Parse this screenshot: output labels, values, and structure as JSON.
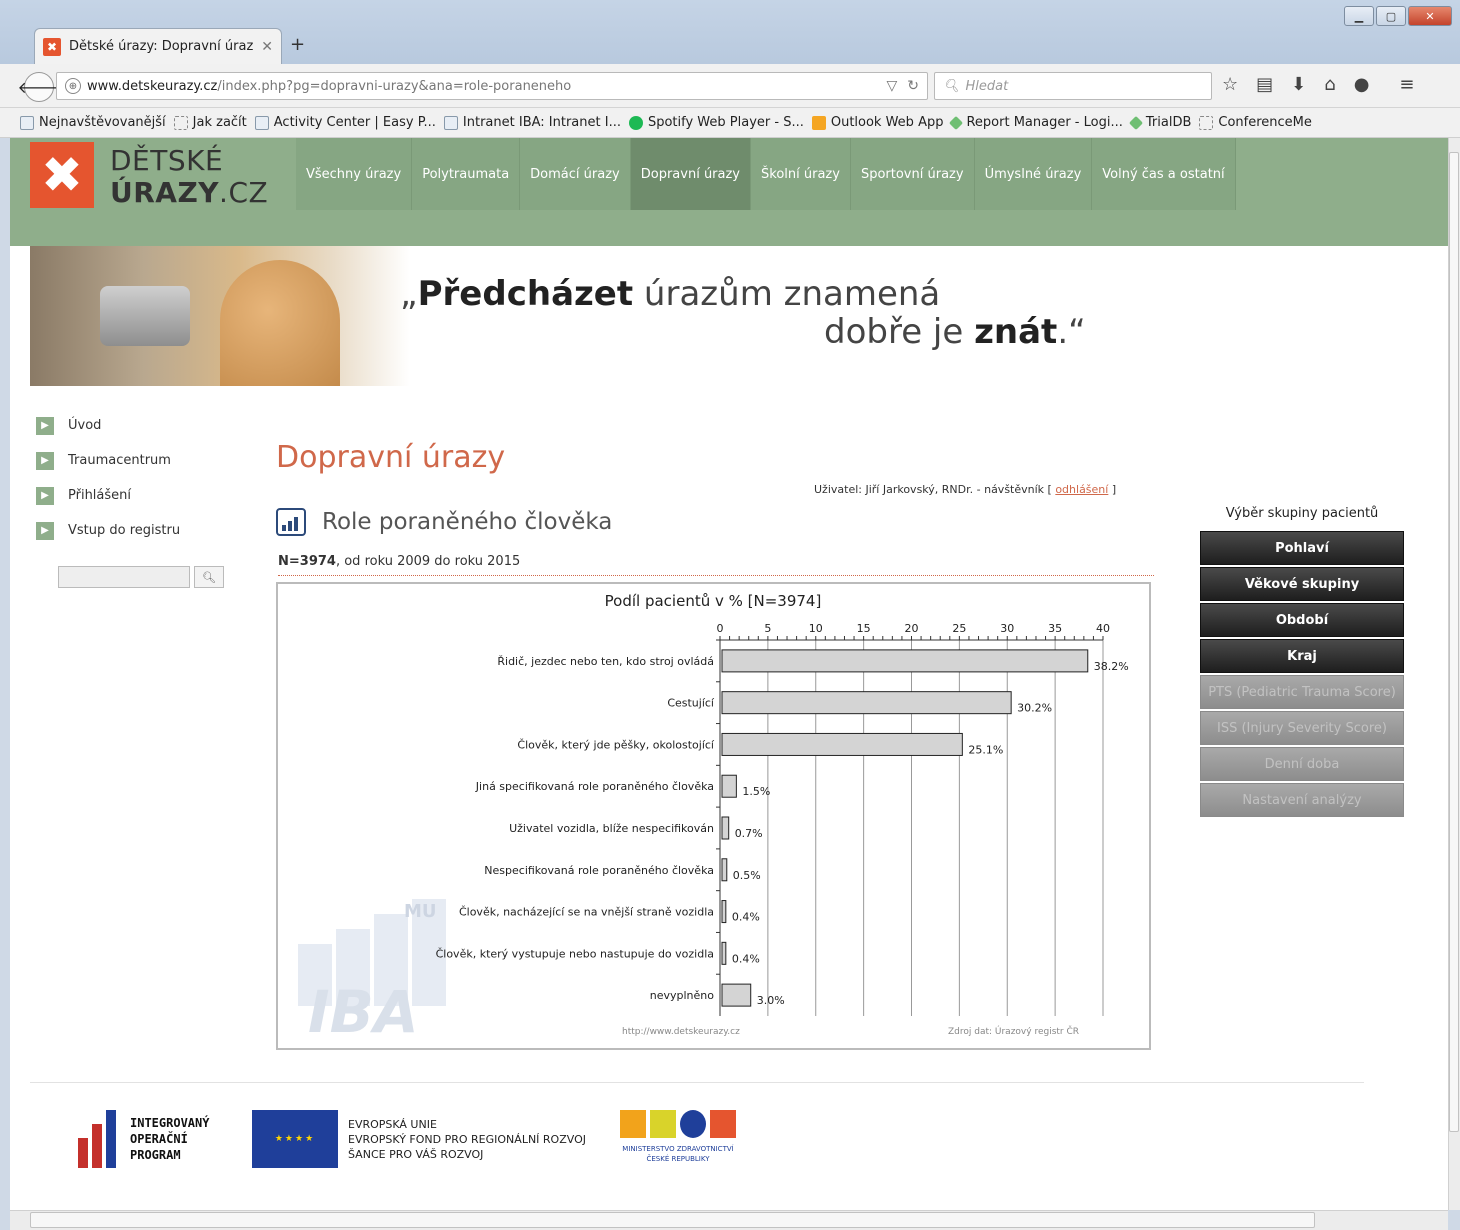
{
  "browser": {
    "tab_title": "Dětské úrazy: Dopravní úrazy",
    "url_domain": "www.detskeurazy.cz",
    "url_path": "/index.php?pg=dopravni-urazy&ana=role-poraneneho",
    "search_placeholder": "Hledat",
    "bookmarks": [
      "Nejnavštěvovanější",
      "Jak začít",
      "Activity Center | Easy P...",
      "Intranet IBA: Intranet I...",
      "Spotify Web Player - S...",
      "Outlook Web App",
      "Report Manager - Logi...",
      "TrialDB",
      "ConferenceMe"
    ]
  },
  "logo": {
    "line1": "DĚTSKÉ",
    "line2_bold": "ÚRAZY",
    "line2_rest": ".CZ"
  },
  "mainnav": [
    "Všechny úrazy",
    "Polytraumata",
    "Domácí úrazy",
    "Dopravní úrazy",
    "Školní úrazy",
    "Sportovní úrazy",
    "Úmyslné úrazy",
    "Volný čas a ostatní"
  ],
  "mainnav_active": 3,
  "banner": {
    "q_open": "„",
    "word1_bold": "Předcházet",
    "rest1": " úrazům znamená",
    "rest2": "dobře je ",
    "word2_bold": "znát",
    "q_close": ".“"
  },
  "sidebar": {
    "items": [
      "Úvod",
      "Traumacentrum",
      "Přihlášení",
      "Vstup do registru"
    ],
    "search_icon": "magnifier-icon"
  },
  "page": {
    "title": "Dopravní úrazy",
    "user_label": "Uživatel: Jiří Jarkovský, RNDr. - návštěvník [ ",
    "user_link": "odhlášení",
    "user_close": " ]",
    "section_title": "Role poraněného člověka",
    "n_bold": "N=3974",
    "n_rest": ", od roku 2009 do roku 2015"
  },
  "chart_data": {
    "type": "bar",
    "orientation": "horizontal",
    "title": "Podíl pacientů v % [N=3974]",
    "categories": [
      "Řidič, jezdec nebo ten, kdo stroj ovládá",
      "Cestující",
      "Člověk, který jde pěšky, okolostojící",
      "Jiná specifikovaná role poraněného člověka",
      "Uživatel vozidla, blíže nespecifikován",
      "Nespecifikovaná role poraněného člověka",
      "Člověk, nacházející se na vnější straně vozidla",
      "Člověk, který vystupuje nebo nastupuje do vozidla",
      "nevyplněno"
    ],
    "values": [
      38.2,
      30.2,
      25.1,
      1.5,
      0.7,
      0.5,
      0.4,
      0.4,
      3.0
    ],
    "value_labels": [
      "38.2%",
      "30.2%",
      "25.1%",
      "1.5%",
      "0.7%",
      "0.5%",
      "0.4%",
      "0.4%",
      "3.0%"
    ],
    "xlim": [
      0,
      40
    ],
    "xticks": [
      0,
      5,
      10,
      15,
      20,
      25,
      30,
      35,
      40
    ],
    "axis_position": "top",
    "grid": true,
    "bar_color": "#d4d4d4",
    "watermark_small": "MU",
    "watermark_big": "IBA",
    "footer_left": "http://www.detskeurazy.cz",
    "footer_right": "Zdroj dat: Úrazový registr ČR"
  },
  "rpanel": {
    "title": "Výběr skupiny pacientů",
    "buttons": [
      {
        "label": "Pohlaví",
        "enabled": true
      },
      {
        "label": "Věkové skupiny",
        "enabled": true
      },
      {
        "label": "Období",
        "enabled": true
      },
      {
        "label": "Kraj",
        "enabled": true
      },
      {
        "label": "PTS (Pediatric Trauma Score)",
        "enabled": false
      },
      {
        "label": "ISS (Injury Severity Score)",
        "enabled": false
      },
      {
        "label": "Denní doba",
        "enabled": false
      },
      {
        "label": "Nastavení analýzy",
        "enabled": false
      }
    ]
  },
  "footer": {
    "iop_lines": [
      "INTEGROVANÝ",
      "OPERAČNÍ",
      "PROGRAM"
    ],
    "eu_lines": [
      "EVROPSKÁ UNIE",
      "EVROPSKÝ FOND PRO REGIONÁLNÍ ROZVOJ",
      "ŠANCE PRO VÁŠ ROZVOJ"
    ],
    "mz_lines": [
      "MINISTERSTVO ZDRAVOTNICTVÍ",
      "ČESKÉ REPUBLIKY"
    ]
  },
  "colors": {
    "accent": "#d0684a",
    "header_green": "#8fae8b",
    "logo_orange": "#e5552f"
  }
}
